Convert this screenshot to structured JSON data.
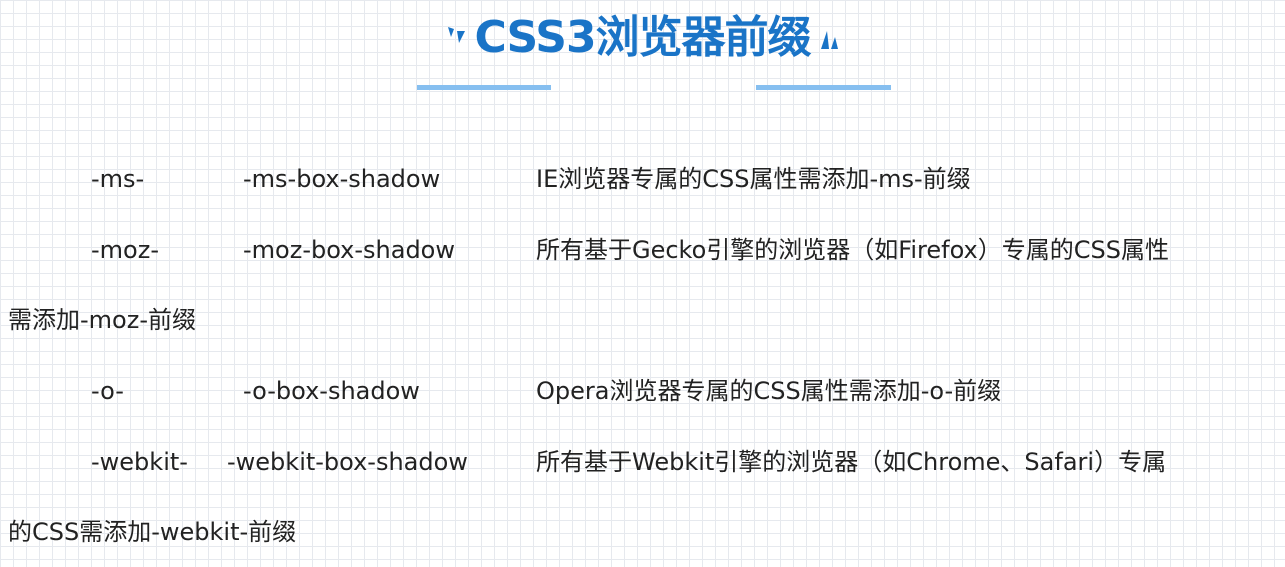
{
  "title": {
    "text": "CSS3浏览器前缀",
    "color": "#1a74c7",
    "underline_color": "#86bff0"
  },
  "rows": [
    {
      "prefix": "-ms-",
      "example": "-ms-box-shadow",
      "description": "IE浏览器专属的CSS属性需添加-ms-前缀",
      "continuation": ""
    },
    {
      "prefix": "-moz-",
      "example": "-moz-box-shadow",
      "description": "所有基于Gecko引擎的浏览器（如Firefox）专属的CSS属性",
      "continuation": "需添加-moz-前缀"
    },
    {
      "prefix": "-o-",
      "example": "-o-box-shadow",
      "description": "Opera浏览器专属的CSS属性需添加-o-前缀",
      "continuation": ""
    },
    {
      "prefix": "-webkit-",
      "example": "-webkit-box-shadow",
      "description": "所有基于Webkit引擎的浏览器（如Chrome、Safari）专属",
      "continuation": "的CSS需添加-webkit-前缀"
    }
  ]
}
